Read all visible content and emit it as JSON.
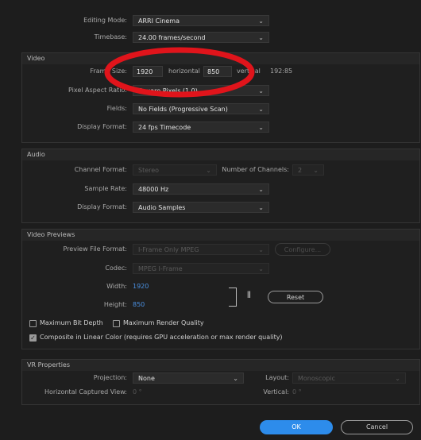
{
  "top": {
    "editing_mode_label": "Editing Mode:",
    "editing_mode_value": "ARRI Cinema",
    "timebase_label": "Timebase:",
    "timebase_value": "24.00  frames/second"
  },
  "video": {
    "title": "Video",
    "frame_size_label": "Frame Size:",
    "frame_width": "1920",
    "horizontal_label": "horizontal",
    "frame_height": "850",
    "vertical_label": "vertical",
    "aspect_ratio": "192:85",
    "pixel_aspect_label": "Pixel Aspect Ratio:",
    "pixel_aspect_value": "Square Pixels (1.0)",
    "fields_label": "Fields:",
    "fields_value": "No Fields (Progressive Scan)",
    "display_format_label": "Display Format:",
    "display_format_value": "24 fps Timecode"
  },
  "audio": {
    "title": "Audio",
    "channel_format_label": "Channel Format:",
    "channel_format_value": "Stereo",
    "num_channels_label": "Number of Channels:",
    "num_channels_value": "2",
    "sample_rate_label": "Sample Rate:",
    "sample_rate_value": "48000 Hz",
    "display_format_label": "Display Format:",
    "display_format_value": "Audio Samples"
  },
  "previews": {
    "title": "Video Previews",
    "file_format_label": "Preview File Format:",
    "file_format_value": "I-Frame Only MPEG",
    "configure_label": "Configure...",
    "codec_label": "Codec:",
    "codec_value": "MPEG I-Frame",
    "width_label": "Width:",
    "width_value": "1920",
    "height_label": "Height:",
    "height_value": "850",
    "reset_label": "Reset",
    "max_bit_depth_label": "Maximum Bit Depth",
    "max_render_quality_label": "Maximum Render Quality",
    "composite_label": "Composite in Linear Color (requires GPU acceleration or max render quality)"
  },
  "vr": {
    "title": "VR Properties",
    "projection_label": "Projection:",
    "projection_value": "None",
    "layout_label": "Layout:",
    "layout_value": "Monoscopic",
    "h_view_label": "Horizontal Captured View:",
    "h_view_value": "0 °",
    "vertical_label": "Vertical:",
    "vertical_value": "0 °"
  },
  "buttons": {
    "ok": "OK",
    "cancel": "Cancel"
  },
  "colors": {
    "accent": "#2d8ceb",
    "annotation": "#e0141b"
  }
}
